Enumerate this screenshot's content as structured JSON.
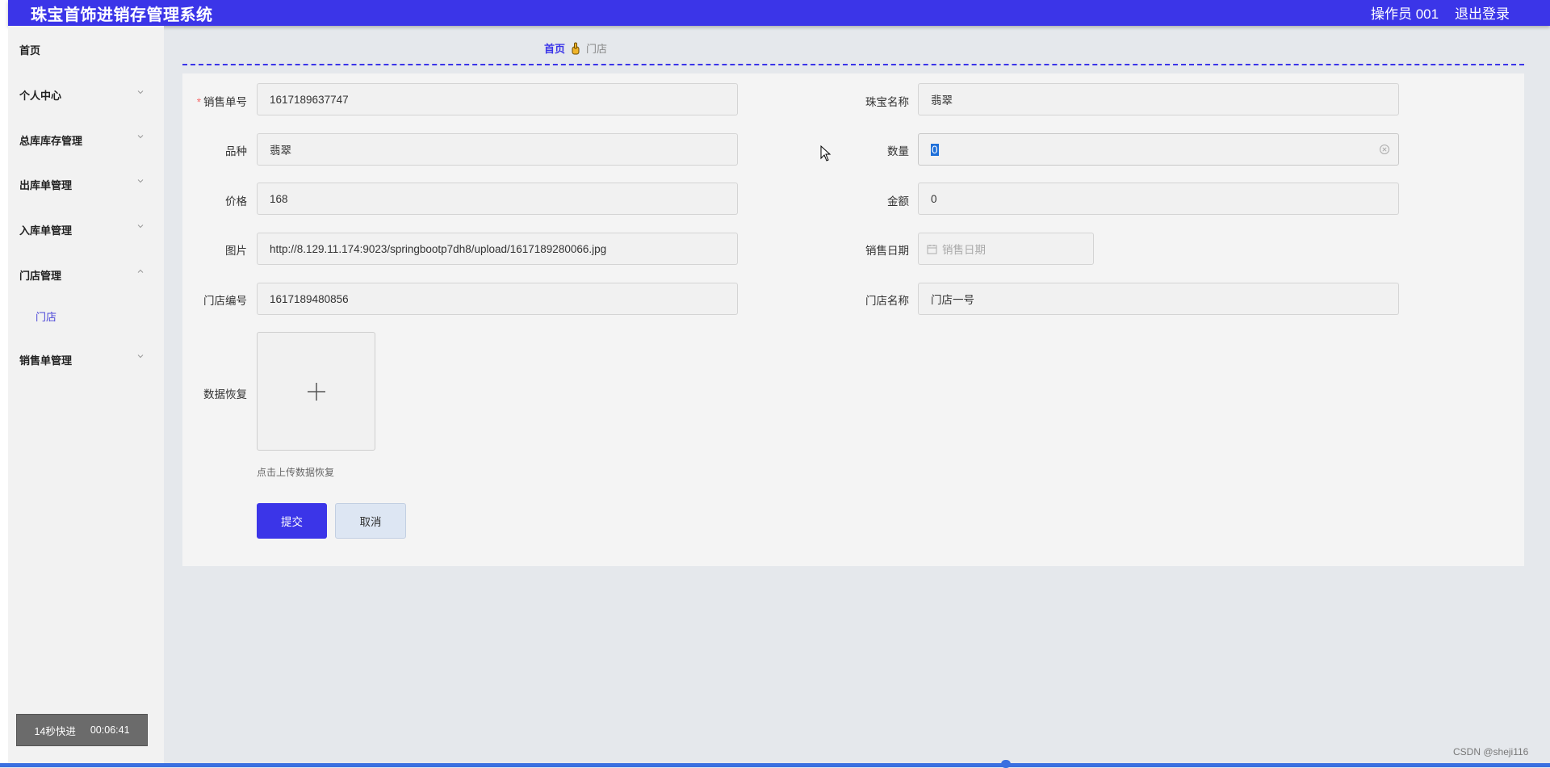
{
  "header": {
    "title": "珠宝首饰进销存管理系统",
    "operator": "操作员 001",
    "logout": "退出登录"
  },
  "sidebar": {
    "items": [
      {
        "label": "首页"
      },
      {
        "label": "个人中心"
      },
      {
        "label": "总库库存管理"
      },
      {
        "label": "出库单管理"
      },
      {
        "label": "入库单管理"
      },
      {
        "label": "门店管理"
      },
      {
        "label": "销售单管理"
      }
    ],
    "sub_item": "门店"
  },
  "breadcrumb": {
    "home": "首页",
    "current": "门店"
  },
  "form": {
    "sale_no": {
      "label": "销售单号",
      "value": "1617189637747"
    },
    "jewel_name": {
      "label": "珠宝名称",
      "value": "翡翠"
    },
    "variety": {
      "label": "品种",
      "value": "翡翠"
    },
    "quantity": {
      "label": "数量",
      "value": "0"
    },
    "price": {
      "label": "价格",
      "value": "168"
    },
    "amount": {
      "label": "金额",
      "value": "0"
    },
    "image": {
      "label": "图片",
      "value": "http://8.129.11.174:9023/springbootp7dh8/upload/1617189280066.jpg"
    },
    "sale_date": {
      "label": "销售日期",
      "placeholder": "销售日期"
    },
    "store_no": {
      "label": "门店编号",
      "value": "1617189480856"
    },
    "store_name": {
      "label": "门店名称",
      "value": "门店一号"
    },
    "restore": {
      "label": "数据恢复",
      "hint": "点击上传数据恢复"
    },
    "submit": "提交",
    "cancel": "取消"
  },
  "recorder": {
    "mode": "14秒快进",
    "time": "00:06:41"
  },
  "watermark": "CSDN @sheji116",
  "colors": {
    "primary": "#3b35e8",
    "progress": "#3a6fe0"
  }
}
